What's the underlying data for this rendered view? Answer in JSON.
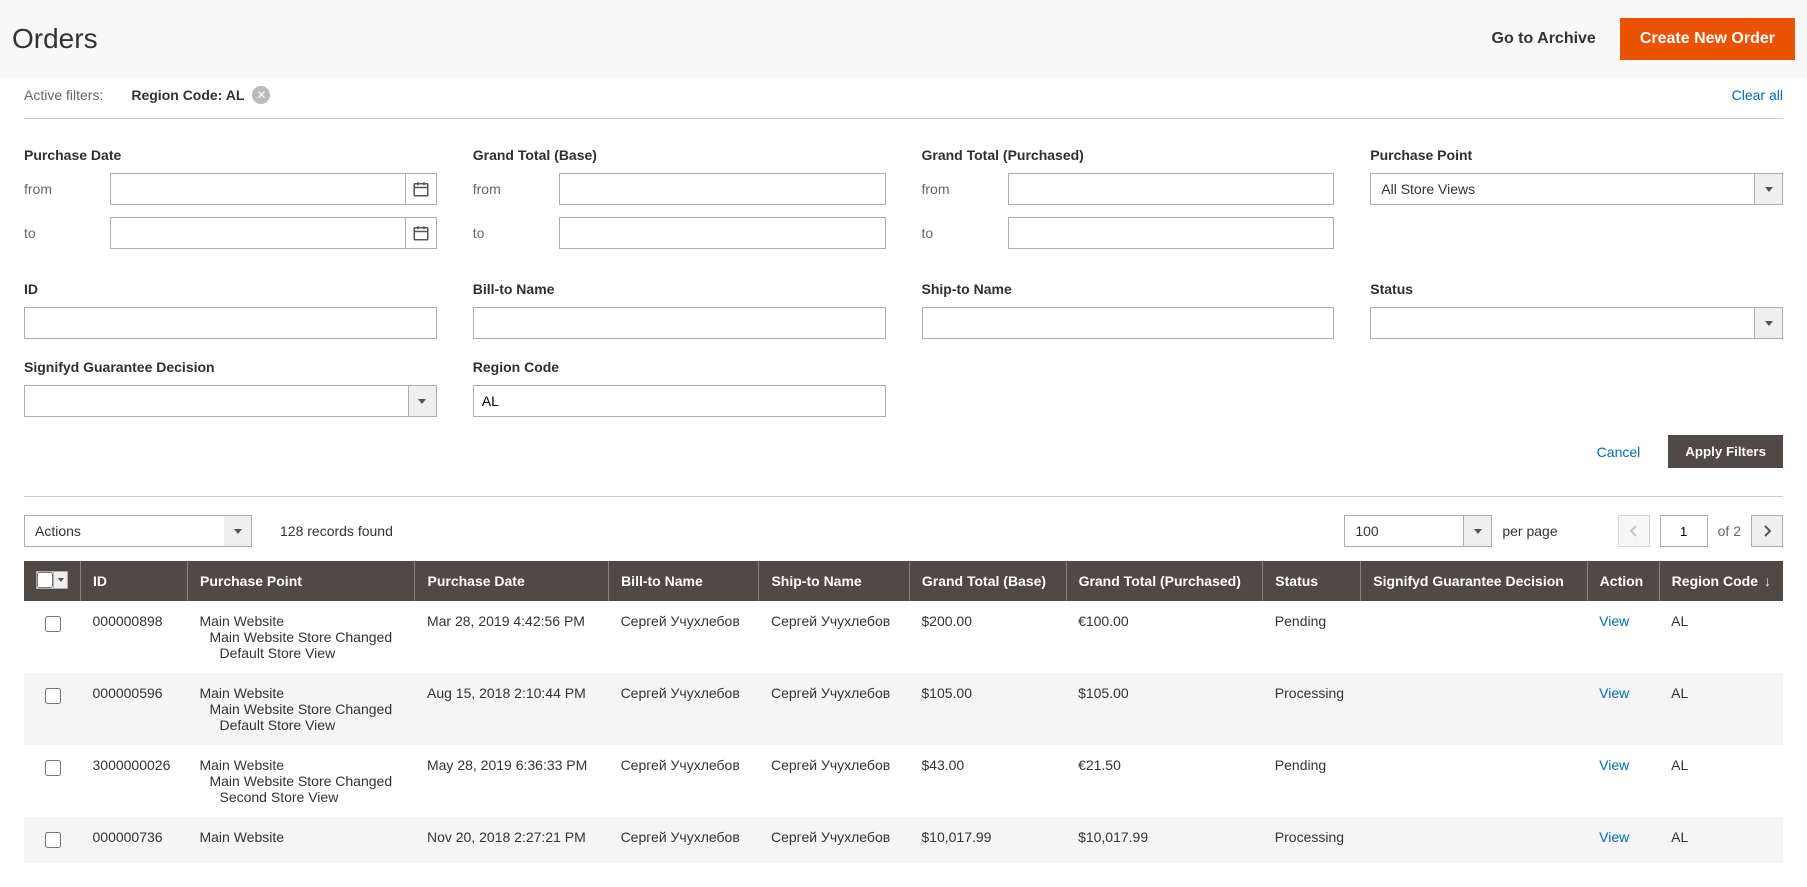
{
  "header": {
    "title": "Orders",
    "go_to_archive": "Go to Archive",
    "create_new_order": "Create New Order"
  },
  "active_filters": {
    "label": "Active filters:",
    "chip_label": "Region Code:",
    "chip_value": "AL",
    "clear_all": "Clear all"
  },
  "filters": {
    "purchase_date": {
      "title": "Purchase Date",
      "from_label": "from",
      "to_label": "to"
    },
    "grand_total_base": {
      "title": "Grand Total (Base)",
      "from_label": "from",
      "to_label": "to"
    },
    "grand_total_purchased": {
      "title": "Grand Total (Purchased)",
      "from_label": "from",
      "to_label": "to"
    },
    "purchase_point": {
      "title": "Purchase Point",
      "value": "All Store Views"
    },
    "id": {
      "title": "ID"
    },
    "bill_to_name": {
      "title": "Bill-to Name"
    },
    "ship_to_name": {
      "title": "Ship-to Name"
    },
    "status": {
      "title": "Status"
    },
    "signifyd": {
      "title": "Signifyd Guarantee Decision"
    },
    "region_code": {
      "title": "Region Code",
      "value": "AL"
    }
  },
  "filter_actions": {
    "cancel": "Cancel",
    "apply": "Apply Filters"
  },
  "toolbar": {
    "actions_label": "Actions",
    "records_found": "128 records found",
    "per_page_value": "100",
    "per_page_label": "per page",
    "current_page": "1",
    "page_of": "of 2"
  },
  "columns": {
    "id": "ID",
    "purchase_point": "Purchase Point",
    "purchase_date": "Purchase Date",
    "bill_to_name": "Bill-to Name",
    "ship_to_name": "Ship-to Name",
    "grand_total_base": "Grand Total (Base)",
    "grand_total_purchased": "Grand Total (Purchased)",
    "status": "Status",
    "signifyd": "Signifyd Guarantee Decision",
    "action": "Action",
    "region_code": "Region Code"
  },
  "rows": [
    {
      "id": "000000898",
      "pp1": "Main Website",
      "pp2": "Main Website Store Changed",
      "pp3": "Default Store View",
      "date": "Mar 28, 2019 4:42:56 PM",
      "bill_to": "Сергей Учухлебов",
      "ship_to": "Сергей Учухлебов",
      "gt_base": "$200.00",
      "gt_purchased": "€100.00",
      "status": "Pending",
      "signifyd": "",
      "action": "View",
      "region": "AL"
    },
    {
      "id": "000000596",
      "pp1": "Main Website",
      "pp2": "Main Website Store Changed",
      "pp3": "Default Store View",
      "date": "Aug 15, 2018 2:10:44 PM",
      "bill_to": "Сергей Учухлебов",
      "ship_to": "Сергей Учухлебов",
      "gt_base": "$105.00",
      "gt_purchased": "$105.00",
      "status": "Processing",
      "signifyd": "",
      "action": "View",
      "region": "AL"
    },
    {
      "id": "3000000026",
      "pp1": "Main Website",
      "pp2": "Main Website Store Changed",
      "pp3": "Second Store View",
      "date": "May 28, 2019 6:36:33 PM",
      "bill_to": "Сергей Учухлебов",
      "ship_to": "Сергей Учухлебов",
      "gt_base": "$43.00",
      "gt_purchased": "€21.50",
      "status": "Pending",
      "signifyd": "",
      "action": "View",
      "region": "AL"
    },
    {
      "id": "000000736",
      "pp1": "Main Website",
      "pp2": "",
      "pp3": "",
      "date": "Nov 20, 2018 2:27:21 PM",
      "bill_to": "Сергей Учухлебов",
      "ship_to": "Сергей Учухлебов",
      "gt_base": "$10,017.99",
      "gt_purchased": "$10,017.99",
      "status": "Processing",
      "signifyd": "",
      "action": "View",
      "region": "AL"
    }
  ]
}
